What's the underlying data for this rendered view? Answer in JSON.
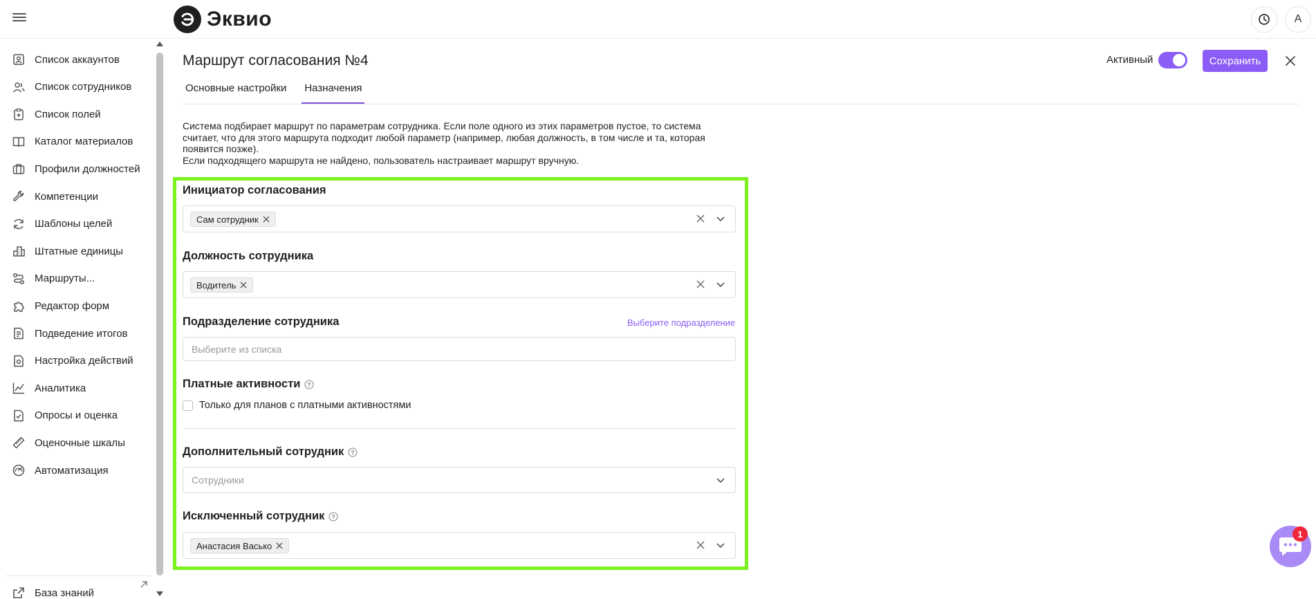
{
  "app": {
    "logo_text": "Эквио",
    "avatar_letter": "A"
  },
  "sidebar": {
    "items": [
      {
        "label": "Список аккаунтов",
        "icon": "account-list-icon"
      },
      {
        "label": "Список сотрудников",
        "icon": "employees-icon"
      },
      {
        "label": "Список полей",
        "icon": "clipboard-icon"
      },
      {
        "label": "Каталог материалов",
        "icon": "book-icon"
      },
      {
        "label": "Профили должностей",
        "icon": "briefcase-icon"
      },
      {
        "label": "Компетенции",
        "icon": "wrench-icon"
      },
      {
        "label": "Шаблоны целей",
        "icon": "refresh-icon"
      },
      {
        "label": "Штатные единицы",
        "icon": "building-icon"
      },
      {
        "label": "Маршруты...",
        "icon": "route-icon"
      },
      {
        "label": "Редактор форм",
        "icon": "puzzle-icon"
      },
      {
        "label": "Подведение итогов",
        "icon": "document-icon"
      },
      {
        "label": "Настройка действий",
        "icon": "file-settings-icon"
      },
      {
        "label": "Аналитика",
        "icon": "chart-line-icon"
      },
      {
        "label": "Опросы и оценка",
        "icon": "survey-icon"
      },
      {
        "label": "Оценочные шкалы",
        "icon": "ruler-icon"
      },
      {
        "label": "Автоматизация",
        "icon": "gauge-icon"
      }
    ],
    "knowledge_base": "База знаний"
  },
  "page": {
    "title": "Маршрут согласования №4",
    "tabs": [
      {
        "label": "Основные настройки",
        "active": false
      },
      {
        "label": "Назначения",
        "active": true
      }
    ],
    "active_label": "Активный",
    "active_on": true,
    "save_label": "Сохранить",
    "info_lines": [
      "Система подбирает маршрут по параметрам сотрудника. Если поле одного из этих параметров пустое, то система",
      "считает, что для этого маршрута подходит любой параметр (например, любая должность, в том числе и та, которая",
      "появится позже).",
      "Если подходящего маршрута не найдено, пользователь настраивает маршрут вручную."
    ]
  },
  "form": {
    "initiator": {
      "title": "Инициатор согласования",
      "chip": "Сам сотрудник"
    },
    "position": {
      "title": "Должность сотрудника",
      "chip": "Водитель"
    },
    "department": {
      "title": "Подразделение сотрудника",
      "link": "Выберите подразделение",
      "placeholder": "Выберите из списка"
    },
    "paid": {
      "title": "Платные активности",
      "checkbox_label": "Только для планов с платными активностями",
      "checked": false
    },
    "additional": {
      "title": "Дополнительный сотрудник",
      "placeholder": "Сотрудники"
    },
    "excluded": {
      "title": "Исключенный сотрудник",
      "chip": "Анастасия Васько"
    }
  },
  "chat": {
    "badge": "1"
  },
  "colors": {
    "accent": "#8b5cf6",
    "highlight": "#7cf021",
    "badge": "#f0263a"
  }
}
